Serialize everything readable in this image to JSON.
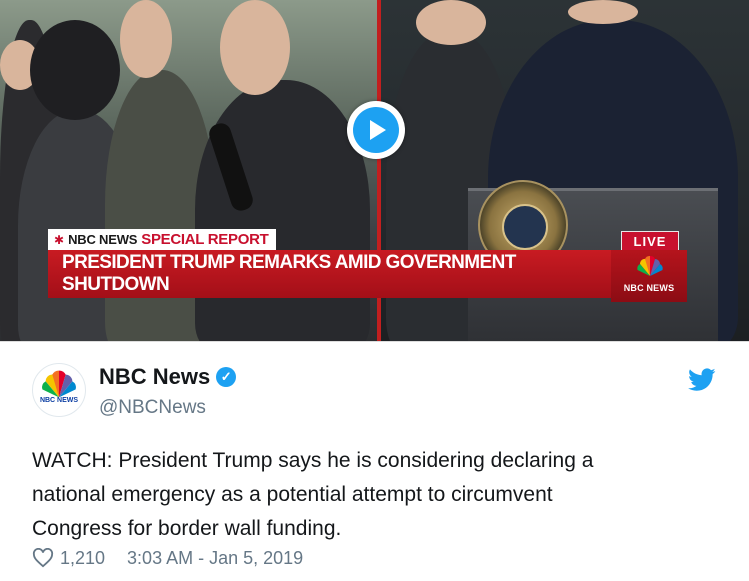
{
  "video": {
    "special_report_network": "NBC NEWS",
    "special_report_label": "SPECIAL REPORT",
    "headline": "PRESIDENT TRUMP REMARKS AMID GOVERNMENT SHUTDOWN",
    "live_badge": "LIVE",
    "network_bug": "NBC NEWS",
    "play_icon": "play-icon"
  },
  "tweet": {
    "avatar_text": "NBC NEWS",
    "display_name": "NBC News",
    "handle": "@NBCNews",
    "verified_icon": "verified-badge-icon",
    "platform_icon": "twitter-bird-icon",
    "text_lines": [
      "WATCH: President Trump says he is considering declaring a",
      "national emergency as a potential attempt to circumvent",
      "Congress for border wall funding."
    ],
    "likes": "1,210",
    "timestamp": "3:03 AM - Jan 5, 2019",
    "like_icon": "heart-icon"
  },
  "colors": {
    "nbc_red": "#c8102e",
    "twitter_blue": "#1da1f2",
    "text_primary": "#14171a",
    "text_secondary": "#657786"
  }
}
